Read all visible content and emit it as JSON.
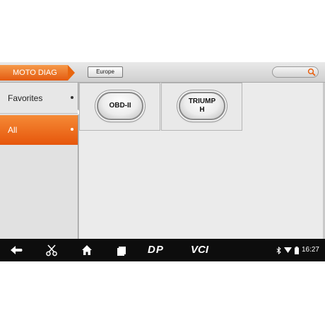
{
  "header": {
    "module_title": "MOTO DIAG",
    "region_button": "Europe",
    "search_icon": "search-icon"
  },
  "sidebar": {
    "items": [
      {
        "label": "Favorites",
        "selected": false
      },
      {
        "label": "All",
        "selected": true
      }
    ]
  },
  "content": {
    "tiles": [
      {
        "label": "OBD-II"
      },
      {
        "label": "TRIUMPH"
      }
    ]
  },
  "navbar": {
    "icons": [
      "back-icon",
      "scissors-icon",
      "home-icon",
      "recent-apps-icon",
      "dp-icon",
      "vci-icon"
    ],
    "dp_label": "DP",
    "vci_label": "VCI",
    "status_icons": [
      "bluetooth-icon",
      "wifi-icon",
      "battery-icon"
    ],
    "clock": "16:27"
  },
  "colors": {
    "accent_orange": "#e8600f",
    "navbar_bg": "#0d0d0d",
    "content_bg": "#ebebeb"
  }
}
